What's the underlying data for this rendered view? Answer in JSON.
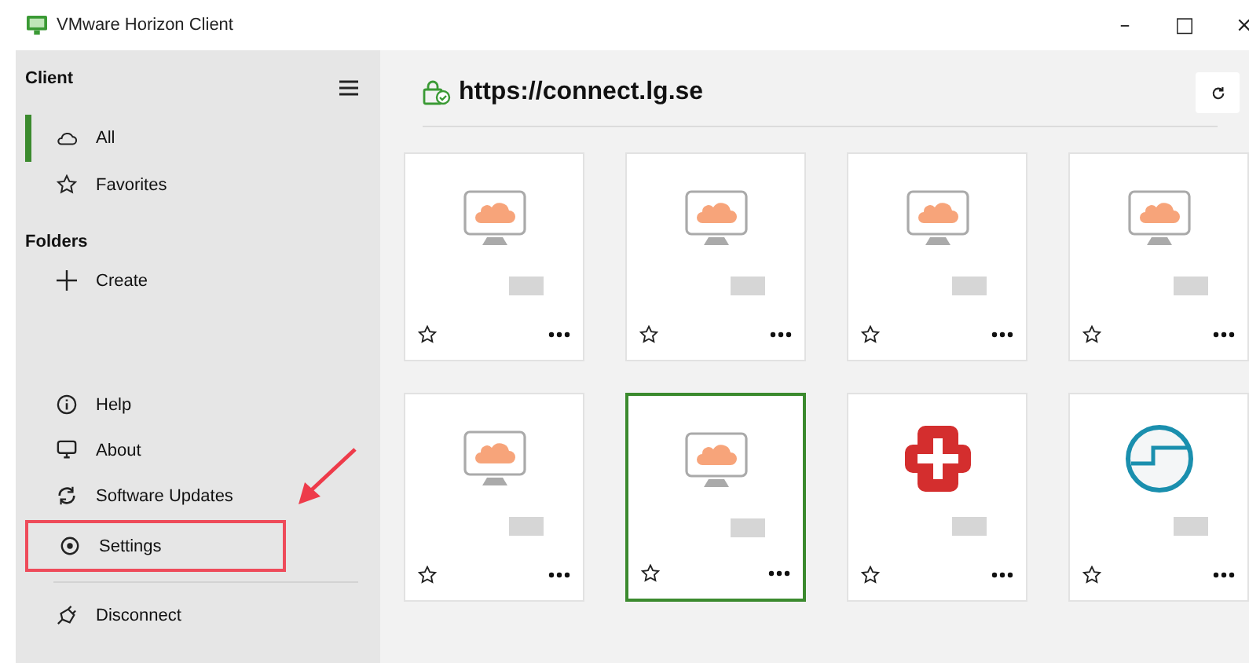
{
  "window": {
    "title": "VMware Horizon Client",
    "controls": [
      "–",
      "□",
      "×"
    ]
  },
  "sidebar": {
    "heading": "Client",
    "items": [
      {
        "kind": "cloud",
        "label": "All",
        "selected": true
      },
      {
        "kind": "star",
        "label": "Favorites",
        "selected": false
      }
    ],
    "folders_heading": "Folders",
    "create": {
      "label": "Create"
    },
    "bottom_items": [
      {
        "kind": "help",
        "label": "Help",
        "highlighted": false
      },
      {
        "kind": "about",
        "label": "About",
        "highlighted": false
      },
      {
        "kind": "updates",
        "label": "Software Updates",
        "highlighted": false
      },
      {
        "kind": "settings",
        "label": "Settings",
        "highlighted": true
      }
    ],
    "disconnect": {
      "label": "Disconnect"
    }
  },
  "server": {
    "url": "https://connect.lg.se"
  },
  "tiles": [
    {
      "kind": "desktop",
      "selected": false
    },
    {
      "kind": "desktop",
      "selected": false
    },
    {
      "kind": "desktop",
      "selected": false
    },
    {
      "kind": "desktop",
      "selected": false
    },
    {
      "kind": "desktop",
      "selected": false
    },
    {
      "kind": "desktop",
      "selected": true
    },
    {
      "kind": "medical",
      "selected": false
    },
    {
      "kind": "ring",
      "selected": false
    }
  ]
}
